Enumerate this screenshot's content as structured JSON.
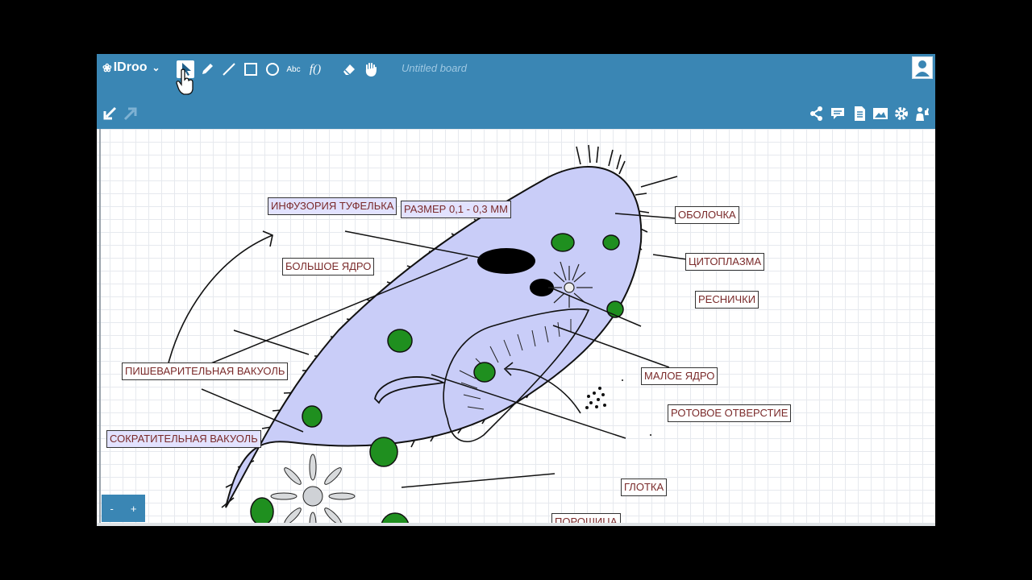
{
  "app": {
    "logo_text": "IDroo",
    "board_title": "Untitled board"
  },
  "toolbar": {
    "tools": [
      "select-icon",
      "pencil-icon",
      "line-icon",
      "rectangle-icon",
      "circle-icon",
      "text-icon",
      "formula-icon",
      "eraser-icon",
      "hand-icon"
    ],
    "text_tool_label": "Abc",
    "formula_tool_label": "f()",
    "right_tools": [
      "share-icon",
      "comment-icon",
      "document-icon",
      "image-icon",
      "settings-icon",
      "user-thumbs-icon"
    ]
  },
  "zoom": {
    "minus_label": "-",
    "plus_label": "+"
  },
  "labels": {
    "title": "ИНФУЗОРИЯ ТУФЕЛЬКА",
    "size": "РАЗМЕР 0,1 - 0,3 ММ",
    "big_nucleus": "БОЛЬШОЕ ЯДРО",
    "shell": "ОБОЛОЧКА",
    "cytoplasm": "ЦИТОПЛАЗМА",
    "cilia": "РЕСНИЧКИ",
    "small_nucleus": "МАЛОЕ ЯДРО",
    "mouth": "РОТОВОЕ ОТВЕРСТИЕ",
    "digestive_vacuole": "ПИШЕВАРИТЕЛЬНАЯ ВАКУОЛЬ",
    "contractile_vacuole": "СОКРАТИТЕЛЬНАЯ ВАКУОЛЬ",
    "pharynx": "ГЛОТКА",
    "anal_pore": "ПОРОШИЦА"
  },
  "colors": {
    "topbar": "#3a86b4",
    "cell_fill": "#c9cdf8",
    "vacuole_green": "#1f8f1f",
    "label_text": "#7a2a2a"
  }
}
